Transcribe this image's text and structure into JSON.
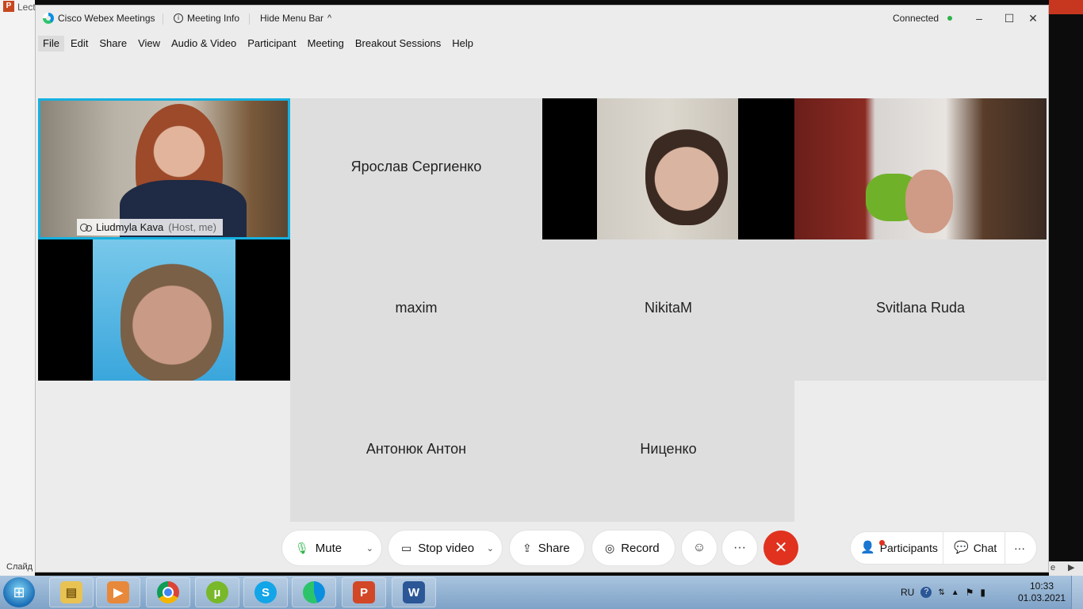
{
  "background": {
    "app_title": "Lect",
    "status_text": "Слайд",
    "right_text": "e"
  },
  "window": {
    "app_name": "Cisco Webex Meetings",
    "meeting_info": "Meeting Info",
    "hide_menu_bar": "Hide Menu Bar",
    "status": "Connected",
    "status_color": "#2cb34a"
  },
  "menu": [
    "File",
    "Edit",
    "Share",
    "View",
    "Audio & Video",
    "Participant",
    "Meeting",
    "Breakout Sessions",
    "Help"
  ],
  "participants": [
    {
      "name": "Liudmyla Kava",
      "role": "(Host, me)",
      "video": true,
      "active": true
    },
    {
      "name": "Ярослав Сергиенко",
      "video": false
    },
    {
      "name": "",
      "video": true
    },
    {
      "name": "",
      "video": true
    },
    {
      "name": "",
      "video": true
    },
    {
      "name": "maxim",
      "video": false
    },
    {
      "name": "NikitaM",
      "video": false
    },
    {
      "name": "Svitlana Ruda",
      "video": false
    },
    {
      "name": "Антонюк Антон",
      "video": false
    },
    {
      "name": "Ниценко",
      "video": false
    }
  ],
  "controls": {
    "mute": "Mute",
    "stop_video": "Stop video",
    "share": "Share",
    "record": "Record",
    "participants": "Participants",
    "chat": "Chat",
    "end_color": "#e0321f"
  },
  "taskbar": {
    "language": "RU",
    "time": "10:33",
    "date": "01.03.2021",
    "apps": [
      "explorer",
      "media-player",
      "chrome",
      "utorrent",
      "skype",
      "webex",
      "powerpoint",
      "word"
    ]
  }
}
